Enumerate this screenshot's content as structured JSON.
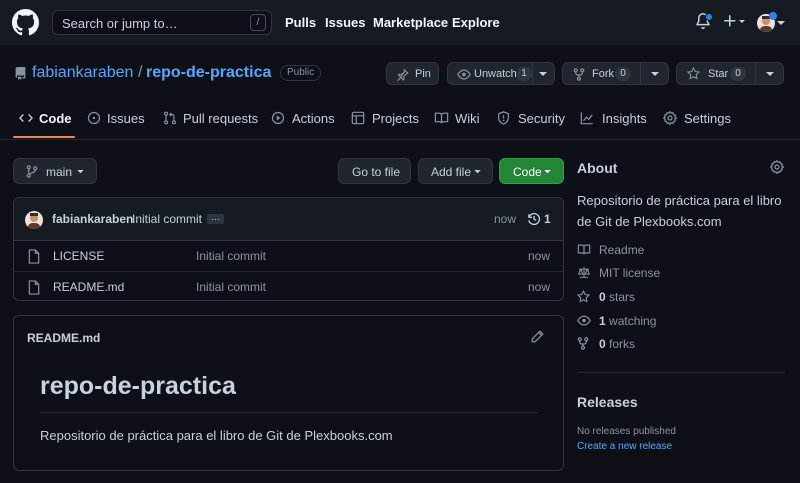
{
  "header": {
    "search_placeholder": "Search or jump to…",
    "search_key": "/",
    "nav": [
      "Pulls",
      "Issues",
      "Marketplace",
      "Explore"
    ]
  },
  "repo": {
    "owner": "fabiankaraben",
    "separator": "/",
    "name": "repo-de-practica",
    "visibility": "Public",
    "pin_label": "Pin",
    "unwatch_label": "Unwatch",
    "watch_count": "1",
    "fork_label": "Fork",
    "fork_count": "0",
    "star_label": "Star",
    "star_count": "0"
  },
  "tabs": [
    "Code",
    "Issues",
    "Pull requests",
    "Actions",
    "Projects",
    "Wiki",
    "Security",
    "Insights",
    "Settings"
  ],
  "toolbar": {
    "branch": "main",
    "go_to_file": "Go to file",
    "add_file": "Add file",
    "code": "Code"
  },
  "commit": {
    "author": "fabiankaraben",
    "message": "Initial commit",
    "dots": "…",
    "time": "now",
    "count": "1"
  },
  "files": [
    {
      "name": "LICENSE",
      "message": "Initial commit",
      "time": "now"
    },
    {
      "name": "README.md",
      "message": "Initial commit",
      "time": "now"
    }
  ],
  "readme": {
    "filename": "README.md",
    "heading": "repo-de-practica",
    "body": "Repositorio de práctica para el libro de Git de Plexbooks.com"
  },
  "about": {
    "title": "About",
    "description": "Repositorio de práctica para el libro de Git de Plexbooks.com",
    "readme": "Readme",
    "license": "MIT license",
    "stars_count": "0",
    "stars_label": "stars",
    "watching_count": "1",
    "watching_label": "watching",
    "forks_count": "0",
    "forks_label": "forks"
  },
  "releases": {
    "title": "Releases",
    "empty": "No releases published",
    "create_link": "Create a new release"
  },
  "colors": {
    "background": "#0d1117",
    "header": "#161b22",
    "link": "#58a6ff",
    "accent_tab": "#f78166",
    "primary_button": "#238636",
    "notification_dot": "#2f81f7"
  }
}
